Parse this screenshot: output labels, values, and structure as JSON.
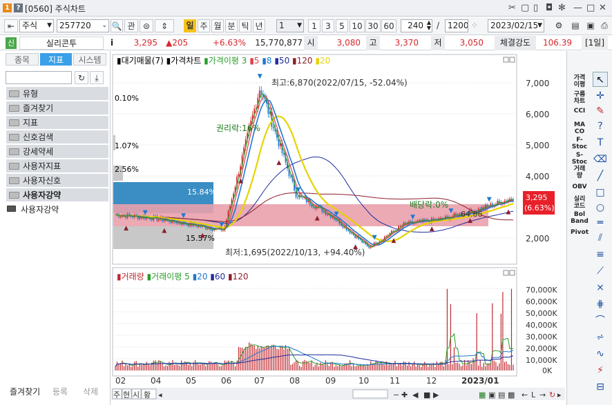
{
  "window": {
    "num1": "1",
    "num2": "?",
    "title": "[0560] 주식차트",
    "controls": [
      "✂",
      "▢",
      "▯",
      "◘",
      "✻",
      "—",
      "□",
      "✕"
    ]
  },
  "toolbar": {
    "market": "주식",
    "code": "257720",
    "btn_search": "🔍",
    "btn_rel": "관",
    "periods": [
      "일",
      "주",
      "월",
      "분",
      "틱",
      "년"
    ],
    "active_period": "일",
    "interval": "1",
    "presets": [
      "1",
      "3",
      "5",
      "10",
      "30",
      "60"
    ],
    "count": "240",
    "total": "1200",
    "date": "2023/02/15"
  },
  "info": {
    "badge": "신",
    "name": "실리콘투",
    "i": "i",
    "price": "3,295",
    "change": "▲205",
    "rate": "+6.63%",
    "volume": "15,770,877",
    "open_l": "시",
    "open": "3,080",
    "high_l": "고",
    "high": "3,370",
    "low_l": "저",
    "low": "3,050",
    "strength_l": "체결강도",
    "strength": "106.39",
    "period_tag": "[1일]"
  },
  "left": {
    "tabs": [
      "종목",
      "지표",
      "시스템"
    ],
    "active_tab": "지표",
    "items": [
      "유형",
      "즐겨찾기",
      "지표",
      "신호검색",
      "강세약세",
      "사용자지표",
      "사용자신호",
      "사용자강약"
    ],
    "subitem": "사용자강약",
    "bottom": [
      "즐겨찾기",
      "등록",
      "삭제"
    ]
  },
  "chart": {
    "price_legend": [
      {
        "t": "대기매물(7)",
        "c": "#000"
      },
      {
        "t": "가격차트",
        "c": "#000"
      },
      {
        "t": "가격이평 3",
        "c": "#2a9d2a"
      },
      {
        "t": "5",
        "c": "#e0404a"
      },
      {
        "t": "8",
        "c": "#1e78d2"
      },
      {
        "t": "50",
        "c": "#1e2b9e"
      },
      {
        "t": "120",
        "c": "#8c1e2a"
      },
      {
        "t": "20",
        "c": "#e6d300"
      }
    ],
    "price_axis": [
      "7,000",
      "6,000",
      "5,000",
      "4,000",
      "2,000"
    ],
    "price_tag": "3,295",
    "price_tag_pct": "(6.63%)",
    "anno_high": "최고:6,870(2022/07/15, -52.04%)",
    "anno_low": "최저:1,695(2022/10/13, +94.40%)",
    "anno_rights": "권리락:16%",
    "anno_div": "배당락:0%",
    "anno_partial": "64.86",
    "vp_labels": [
      "0.10%",
      "1.07%",
      "2.56%",
      "15.84%",
      "15.57%"
    ],
    "vol_legend": [
      {
        "t": "거래량",
        "c": "#c0282e"
      },
      {
        "t": "거래이평 5",
        "c": "#2a9d2a"
      },
      {
        "t": "20",
        "c": "#1e78d2"
      },
      {
        "t": "60",
        "c": "#1e2b9e"
      },
      {
        "t": "120",
        "c": "#8c1e2a"
      }
    ],
    "vol_axis": [
      "70,000K",
      "60,000K",
      "50,000K",
      "40,000K",
      "30,000K",
      "20,000K",
      "10,000K",
      "0K"
    ],
    "x_labels": [
      "02",
      "04",
      "05",
      "06",
      "07",
      "08",
      "09",
      "10",
      "11",
      "12",
      "2023/01"
    ],
    "bottom_btns": [
      "주",
      "현",
      "시",
      "황"
    ]
  },
  "right": {
    "labels": [
      "가격\n이평",
      "구름\n차트",
      "CCI",
      "MA\nCO",
      "F-\nStoc",
      "S-\nStoc",
      "거래\n량",
      "OBV",
      "실리\n코드",
      "Bol\nBand",
      "Pivot"
    ]
  },
  "chart_data": {
    "type": "line",
    "title": "",
    "x": [
      "2022/02",
      "2022/04",
      "2022/05",
      "2022/06",
      "2022/07",
      "2022/08",
      "2022/09",
      "2022/10",
      "2022/11",
      "2022/12",
      "2023/01",
      "2023/02"
    ],
    "series": [
      {
        "name": "가격차트",
        "values": [
          2750,
          2650,
          2450,
          2250,
          6870,
          3400,
          2700,
          1695,
          2450,
          2600,
          2900,
          3295
        ]
      }
    ],
    "ylim": [
      1500,
      7300
    ],
    "high": 6870,
    "low": 1695
  }
}
